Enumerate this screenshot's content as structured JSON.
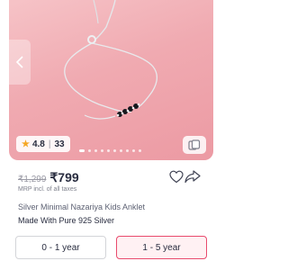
{
  "product": {
    "rating": "4.8",
    "rating_count": "33",
    "mrp": "₹1,299",
    "price": "₹799",
    "mrp_note": "MRP incl. of all taxes",
    "title": "Silver Minimal Nazariya Kids Anklet",
    "subtitle": "Made With Pure 925 Silver"
  },
  "carousel": {
    "slide_count": 10,
    "active_index": 0
  },
  "sizes": [
    {
      "label": "0 - 1 year",
      "selected": false
    },
    {
      "label": "1 - 5 year",
      "selected": true
    }
  ],
  "icons": {
    "prev": "chevron-left-icon",
    "star": "star-icon",
    "similar": "similar-products-icon",
    "wishlist": "heart-icon",
    "share": "share-icon"
  },
  "colors": {
    "background_pink": "#f0aab1",
    "accent": "#e94a6d",
    "rating_star": "#f5a623"
  }
}
